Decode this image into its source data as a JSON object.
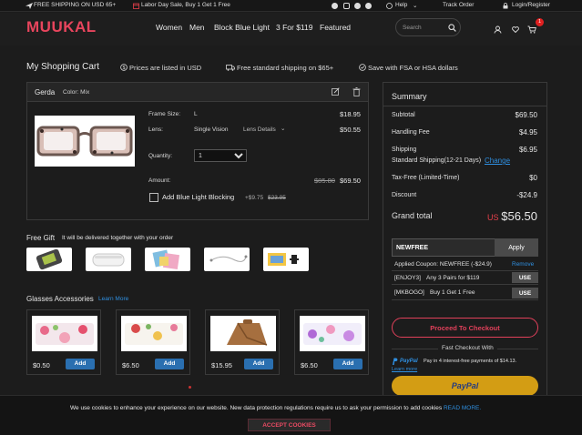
{
  "topbar": {
    "shipping": "FREE SHIPPING ON USD 65+",
    "promo": "Labor Day Sale, Buy 1 Get 1 Free",
    "help": "Help",
    "track": "Track Order",
    "login": "Login/Register"
  },
  "brand": "MUUKAL",
  "nav": {
    "items": [
      "Women",
      "Men",
      "Block Blue Light",
      "3 For $119",
      "Featured"
    ],
    "search_placeholder": "Search",
    "cart_count": "1"
  },
  "page": {
    "title": "My Shopping Cart",
    "notes": [
      "Prices are listed in USD",
      "Free standard shipping on $65+",
      "Save with FSA or HSA dollars"
    ]
  },
  "item": {
    "name": "Gerda",
    "color": "Color: Mix",
    "frame_size_label": "Frame Size:",
    "frame_size": "L",
    "frame_price": "$18.95",
    "lens_label": "Lens:",
    "lens": "Single Vision",
    "lens_details": "Lens Details",
    "lens_price": "$50.55",
    "quantity_label": "Quantity:",
    "quantity": "1",
    "amount_label": "Amount:",
    "amount_old": "$85.80",
    "amount": "$69.50",
    "blue_light_label": "Add Blue Light Blocking",
    "blue_light_price": "+$9.75",
    "blue_light_old": "$23.95"
  },
  "free_gift": {
    "title": "Free Gift",
    "note": "It will be delivered together with your order"
  },
  "accessories": {
    "title": "Glasses Accessories",
    "learn_more": "Learn More",
    "items": [
      {
        "price": "$0.50",
        "button": "Add"
      },
      {
        "price": "$6.50",
        "button": "Add"
      },
      {
        "price": "$15.95",
        "button": "Add"
      },
      {
        "price": "$6.50",
        "button": "Add"
      }
    ]
  },
  "summary": {
    "title": "Summary",
    "subtotal_label": "Subtotal",
    "subtotal": "$69.50",
    "handling_label": "Handling Fee",
    "handling": "$4.95",
    "shipping_label": "Shipping",
    "shipping": "$6.95",
    "shipping_method": "Standard Shipping(12-21 Days)",
    "change": "Change",
    "tax_label": "Tax-Free (Limited-Time)",
    "tax": "$0",
    "discount_label": "Discount",
    "discount": "-$24.9",
    "grand_label": "Grand total",
    "grand_currency": "US",
    "grand": "$56.50",
    "coupon_value": "NEWFREE",
    "apply": "Apply",
    "applied": "Applied Coupon: NEWFREE (-$24.9)",
    "remove": "Remove",
    "offers": [
      {
        "code": "[ENJOY3]",
        "text": "Any 3 Pairs for $119",
        "button": "USE"
      },
      {
        "code": "[MKBOGO]",
        "text": "Buy 1 Get 1 Free",
        "button": "USE"
      }
    ],
    "checkout": "Proceed To Checkout",
    "fast_checkout": "Fast Checkout With",
    "paypal_note": "Pay in 4 interest-free payments of $14.13.",
    "paypal_brand": "PayPal",
    "paypal_learn": "Learn more",
    "paypal_button": "PayPal"
  },
  "cookie": {
    "message": "We use cookies to enhance your experience on our website. New data protection regulations require us to ask your permission to add cookies",
    "read_more": "READ MORE.",
    "accept": "ACCEPT COOKIES"
  },
  "colors": {
    "accent": "#e8455d",
    "link": "#2f8fe0",
    "paypal": "#d39d14",
    "add_button": "#2a6fb0"
  }
}
